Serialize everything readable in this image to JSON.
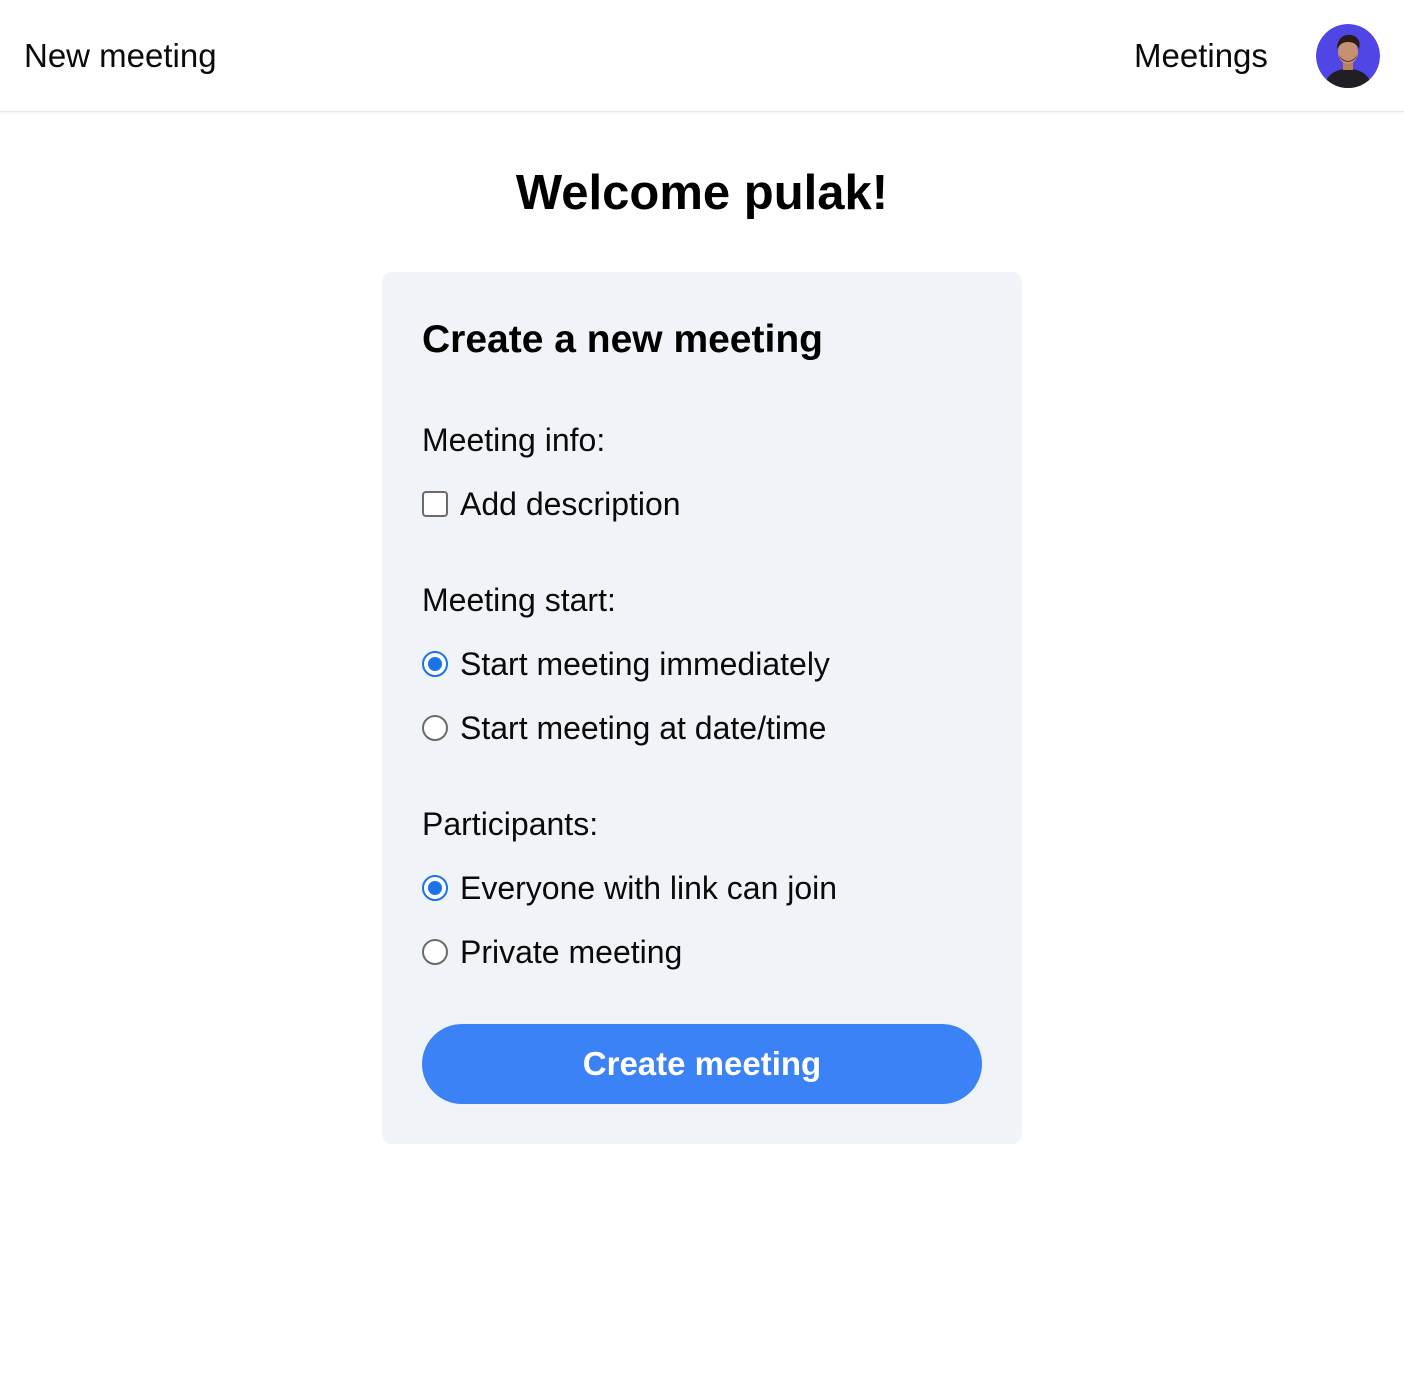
{
  "header": {
    "brand_label": "New meeting",
    "nav": [
      {
        "label": "Meetings"
      }
    ],
    "avatar": {
      "icon": "user-avatar",
      "bg_color": "#4f46e5"
    }
  },
  "main": {
    "welcome": "Welcome pulak!",
    "card": {
      "title": "Create a new meeting",
      "sections": [
        {
          "label": "Meeting info:",
          "options": [
            {
              "type": "checkbox",
              "label": "Add description",
              "checked": false
            }
          ]
        },
        {
          "label": "Meeting start:",
          "options": [
            {
              "type": "radio",
              "label": "Start meeting immediately",
              "checked": true
            },
            {
              "type": "radio",
              "label": "Start meeting at date/time",
              "checked": false
            }
          ]
        },
        {
          "label": "Participants:",
          "options": [
            {
              "type": "radio",
              "label": "Everyone with link can join",
              "checked": true
            },
            {
              "type": "radio",
              "label": "Private meeting",
              "checked": false
            }
          ]
        }
      ],
      "submit_label": "Create meeting"
    }
  },
  "colors": {
    "accent": "#3b82f6",
    "radio_checked": "#1a73e8",
    "card_bg": "#f0f4f8"
  }
}
